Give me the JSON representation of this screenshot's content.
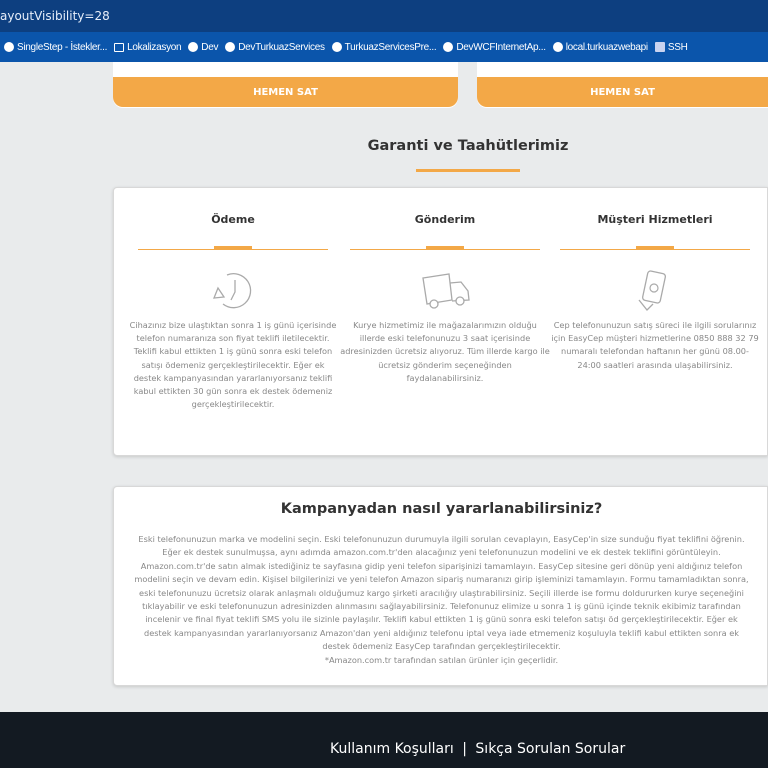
{
  "browser": {
    "url_fragment": "ayoutVisibility=28",
    "bookmarks": [
      {
        "label": "SingleStep - İstekler...",
        "icon": "singlestep-icon"
      },
      {
        "label": "Lokalizasyon",
        "icon": "folder-icon"
      },
      {
        "label": "Dev",
        "icon": "globe-icon"
      },
      {
        "label": "DevTurkuazServices",
        "icon": "globe-icon"
      },
      {
        "label": "TurkuazServicesPre...",
        "icon": "globe-icon"
      },
      {
        "label": "DevWCFInternetAp...",
        "icon": "globe-icon"
      },
      {
        "label": "local.turkuazwebapi",
        "icon": "globe-icon"
      },
      {
        "label": "SSH",
        "icon": "ssh-icon"
      }
    ]
  },
  "products": {
    "sell_button": "HEMEN SAT"
  },
  "guarantee": {
    "title": "Garanti ve Taahütlerimiz",
    "accent": "#f3a847",
    "columns": [
      {
        "title": "Ödeme",
        "icon": "clock-icon",
        "text": "Cihazınız bize ulaştıktan sonra 1 iş günü içerisinde telefon numaranıza son fiyat teklifi iletilecektir. Teklifi kabul ettikten 1 iş günü sonra eski telefon satışı ödemeniz gerçekleştirilecektir. Eğer ek destek kampanyasından yararlanıyorsanız teklifi kabul ettikten 30 gün sonra ek destek ödemeniz gerçekleştirilecektir."
      },
      {
        "title": "Gönderim",
        "icon": "truck-icon",
        "text": "Kurye hizmetimiz ile mağazalarımızın olduğu illerde eski telefonunuzu 3 saat içerisinde adresinizden ücretsiz alıyoruz. Tüm illerde kargo ile ücretsiz gönderim seçeneğinden faydalanabilirsiniz."
      },
      {
        "title": "Müşteri Hizmetleri",
        "icon": "phone-hand-icon",
        "text": "Cep telefonunuzun satış süreci ile ilgili sorularınız için EasyCep müşteri hizmetlerine 0850 888 32 79 numaralı telefondan haftanın her günü 08.00-24:00 saatleri arasında ulaşabilirsiniz."
      }
    ]
  },
  "campaign": {
    "title": "Kampanyadan nasıl yararlanabilirsiniz?",
    "lines": [
      "Eski telefonunuzun marka ve modelini seçin. Eski telefonunuzun durumuyla ilgili sorulan cevaplayın, EasyCep'in size sunduğu fiyat teklifini öğrenin. Eğer ek destek",
      "sunulmuşsa, aynı adımda amazon.com.tr'den alacağınız yeni telefonunuzun modelini ve ek destek teklifini görüntüleyin. Amazon.com.tr'de satın almak istediğiniz te",
      "sayfasına gidip yeni telefon siparişinizi tamamlayın. EasyCep sitesine geri dönüp yeni aldığınız telefon modelini seçin ve devam edin. Kişisel bilgilerinizi ve yeni telefon",
      "Amazon sipariş numaranızı girip işleminizi tamamlayın. Formu tamamladıktan sonra, eski telefonunuzu ücretsiz olarak anlaşmalı olduğumuz kargo şirketi aracılığıy",
      "ulaştırabilirsiniz. Seçili illerde ise formu doldururken kurye seçeneğini tıklayabilir ve eski telefonunuzun adresinizden alınmasını sağlayabilirsiniz. Telefonunuz elimize u",
      "sonra 1 iş günü içinde teknik ekibimiz tarafından incelenir ve final fiyat teklifi SMS yolu ile sizinle paylaşılır. Teklifi kabul ettikten 1 iş günü sonra eski telefon satışı öd",
      "gerçekleştirilecektir. Eğer ek destek kampanyasından yararlanıyorsanız Amazon'dan yeni aldığınız telefonu iptal veya iade etmemeniz koşuluyla teklifi kabul ettikten",
      "sonra ek destek ödemeniz EasyCep tarafından gerçekleştirilecektir.",
      "*Amazon.com.tr tarafından satılan ürünler için geçerlidir."
    ]
  },
  "footer": {
    "terms": "Kullanım Koşulları",
    "separator": "|",
    "faq": "Sıkça Sorulan Sorular"
  }
}
